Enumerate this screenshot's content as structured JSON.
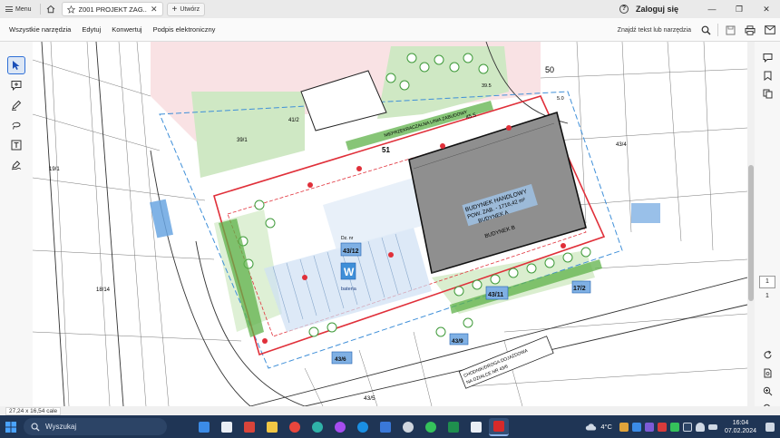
{
  "titlebar": {
    "menu_label": "Menu",
    "tab_title": "Z001 PROJEKT ZAG...",
    "new_tab_label": "Utwórz",
    "login_label": "Zaloguj się"
  },
  "toolbar": {
    "items": [
      "Wszystkie narzędzia",
      "Edytuj",
      "Konwertuj",
      "Podpis elektroniczny"
    ],
    "search_label": "Znajdź tekst lub narzędzia"
  },
  "plan": {
    "parcel_50": "50",
    "parcel_51": "51",
    "parcel_41_2": "41/2",
    "parcel_39_1": "39/1",
    "parcel_43_4": "43/4",
    "parcel_43_12": "43/12",
    "parcel_43_11": "43/11",
    "parcel_43_9": "43/9",
    "parcel_43_6": "43/6",
    "parcel_43_5": "43/5",
    "parcel_17_2": "17/2",
    "parcel_19_1": "19/1",
    "parcel_18_14": "18/14",
    "building_label_1": "BUDYNEK HANDLOWY",
    "building_label_2": "POW. ZAB. - 1716,42 m²",
    "building_label_3": "BUDYNEK A",
    "building_label_4": "BUDYNEK B",
    "boundary_label": "NIEPRZEKRACZALNA LINIA ZABUDOWY",
    "dim_45_5": "45.5",
    "dim_39_5": "39.5",
    "dim_5_0": "5.0",
    "w_label": "W",
    "w_sub": "bateria",
    "road_label": "Dz. nr",
    "chodnik_label_1": "CHODNIK/DROGA DOJAZDOWA",
    "chodnik_label_2": "NA DZIAŁCE NR 43/6"
  },
  "right_rail": {
    "page_current": "1",
    "page_total": "1"
  },
  "statusbar": {
    "page_size": "27,24 x 16,54 cale"
  },
  "taskbar": {
    "search_placeholder": "Wyszukaj",
    "weather": "4°C",
    "time": "16:04",
    "date": "07.02.2024"
  },
  "colors": {
    "accent": "#2f6fd6",
    "building_fill": "#8f8f8f",
    "plot_outline": "#e0303a",
    "green_area": "#5fb24a",
    "water_blue": "#3f8fd8",
    "taskbar": "#1f3555"
  }
}
